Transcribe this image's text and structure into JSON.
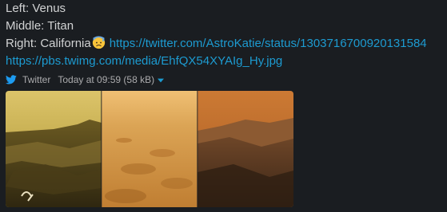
{
  "message": {
    "line1": "Left: Venus",
    "line2": "Middle: Titan",
    "line3_prefix": "Right: California",
    "emoji": "anxious-face-with-sweat-emoji",
    "tweet_url": "https://twitter.com/AstroKatie/status/1303716700920131584",
    "media_url": "https://pbs.twimg.com/media/EhfQX54XYAIg_Hy.jpg"
  },
  "attachment": {
    "service": "Twitter",
    "timestamp": "Today at 09:59",
    "size": "(58 kB)",
    "service_icon": "twitter-bird-icon",
    "menu_icon": "caret-down-icon"
  },
  "image": {
    "panels": [
      "Venus",
      "Titan",
      "California"
    ]
  },
  "colors": {
    "background": "#1a1d21",
    "text": "#d1d2d3",
    "link": "#1d9bd1",
    "meta": "#ababad"
  }
}
